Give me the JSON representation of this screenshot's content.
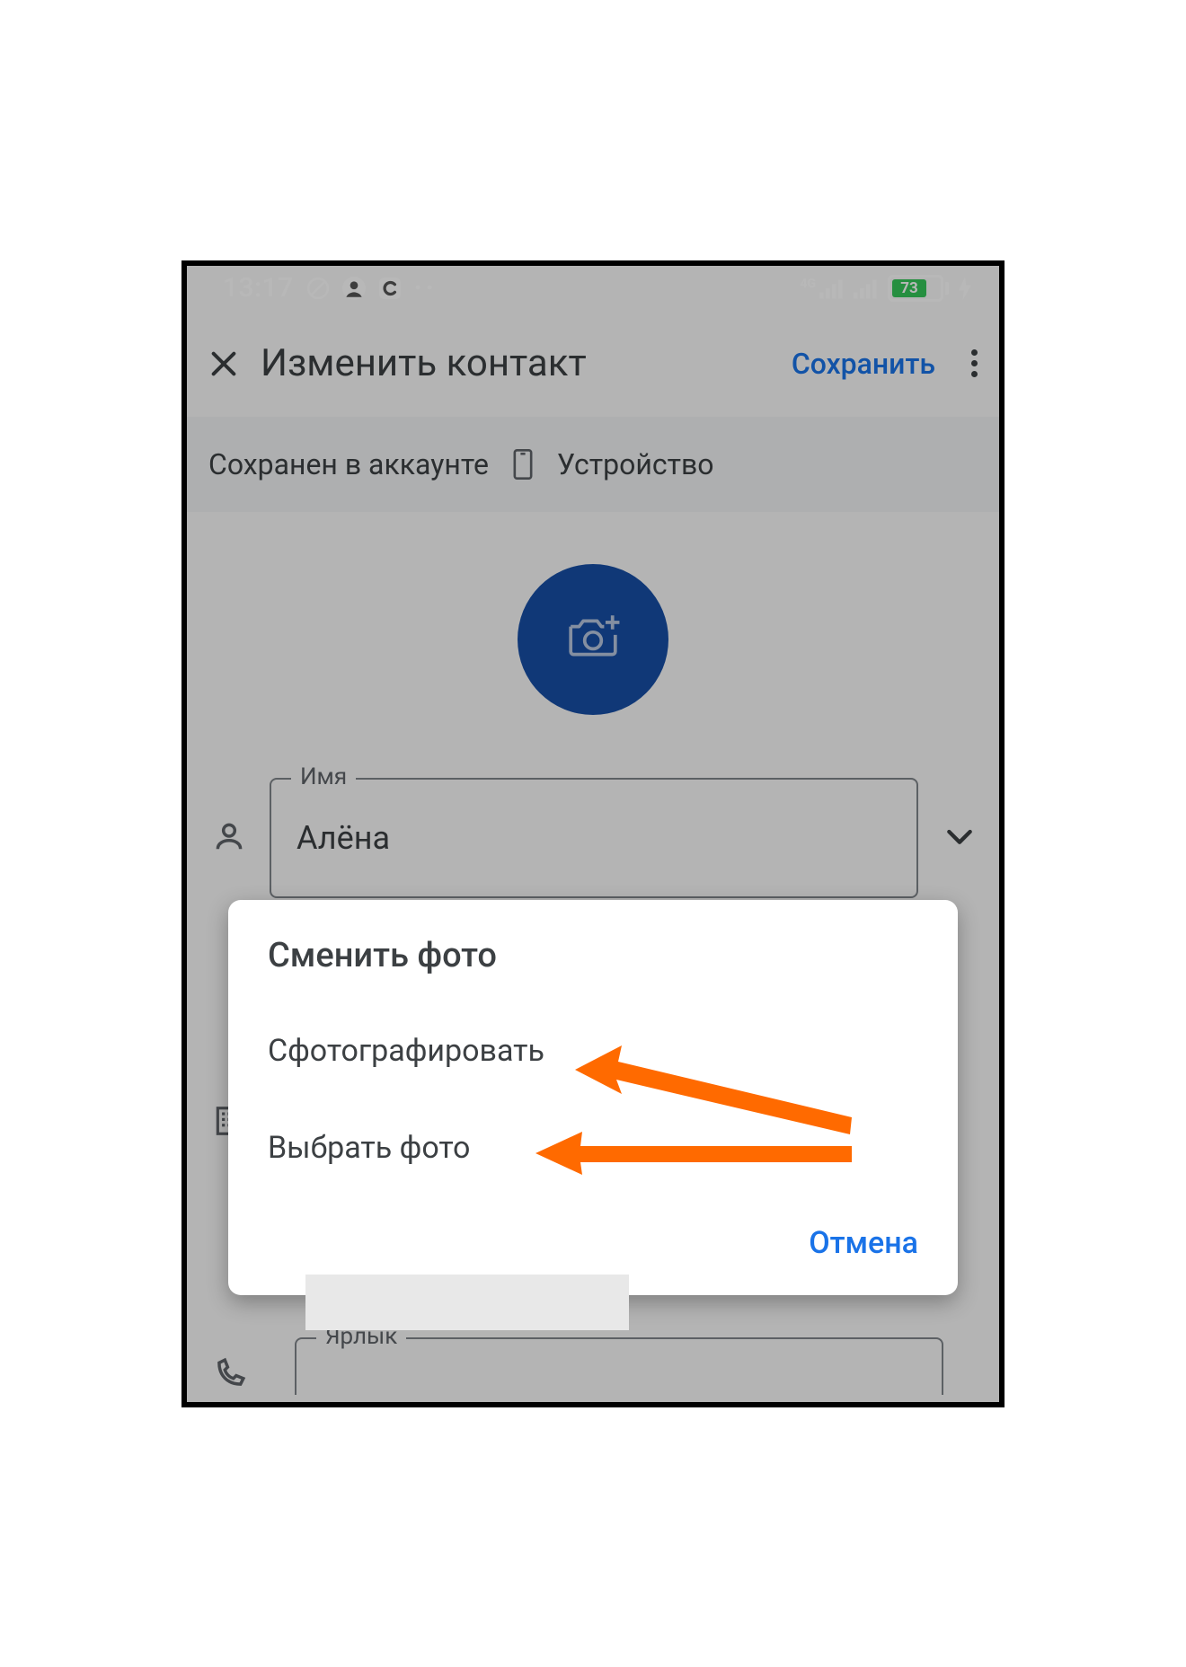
{
  "status": {
    "time": "13:17",
    "network_label": "4G",
    "battery_percent": "73"
  },
  "appbar": {
    "title": "Изменить контакт",
    "save": "Сохранить"
  },
  "account_row": {
    "saved_in": "Сохранен в аккаунте",
    "device": "Устройство"
  },
  "name_field": {
    "label": "Имя",
    "value": "Алёна"
  },
  "next_field": {
    "label": "Ярлык"
  },
  "dialog": {
    "title": "Сменить фото",
    "option_take": "Сфотографировать",
    "option_pick": "Выбрать фото",
    "cancel": "Отмена"
  }
}
